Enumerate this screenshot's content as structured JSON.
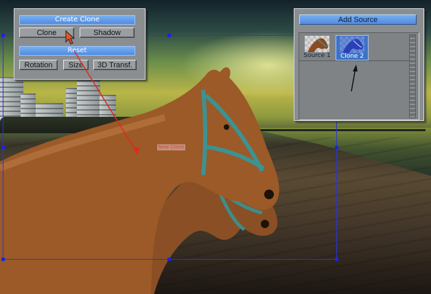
{
  "colors": {
    "accent_bar": "#4f8be2",
    "panel": "#8a8e91",
    "selection": "#2a33d8",
    "red_arrow": "#e0281c"
  },
  "canvas": {
    "clone_label": "New Clone"
  },
  "clone_panel": {
    "title": "Create Clone",
    "clone_button": "Clone",
    "shadow_button": "Shadow",
    "reset_label": "Reset",
    "rotation_button": "Rotation",
    "size_button": "Size",
    "transform_button": "3D Transf."
  },
  "source_panel": {
    "add_button": "Add Source",
    "thumbnails": [
      {
        "label": "Source 1",
        "selected": false,
        "icon": "horse-head-icon"
      },
      {
        "label": "Clone 2",
        "selected": true,
        "icon": "horse-head-icon"
      }
    ]
  },
  "icons": {
    "cursor": "mouse-pointer-icon",
    "arrow_red": "annotation-arrow-icon",
    "arrow_black": "annotation-arrow-icon"
  }
}
